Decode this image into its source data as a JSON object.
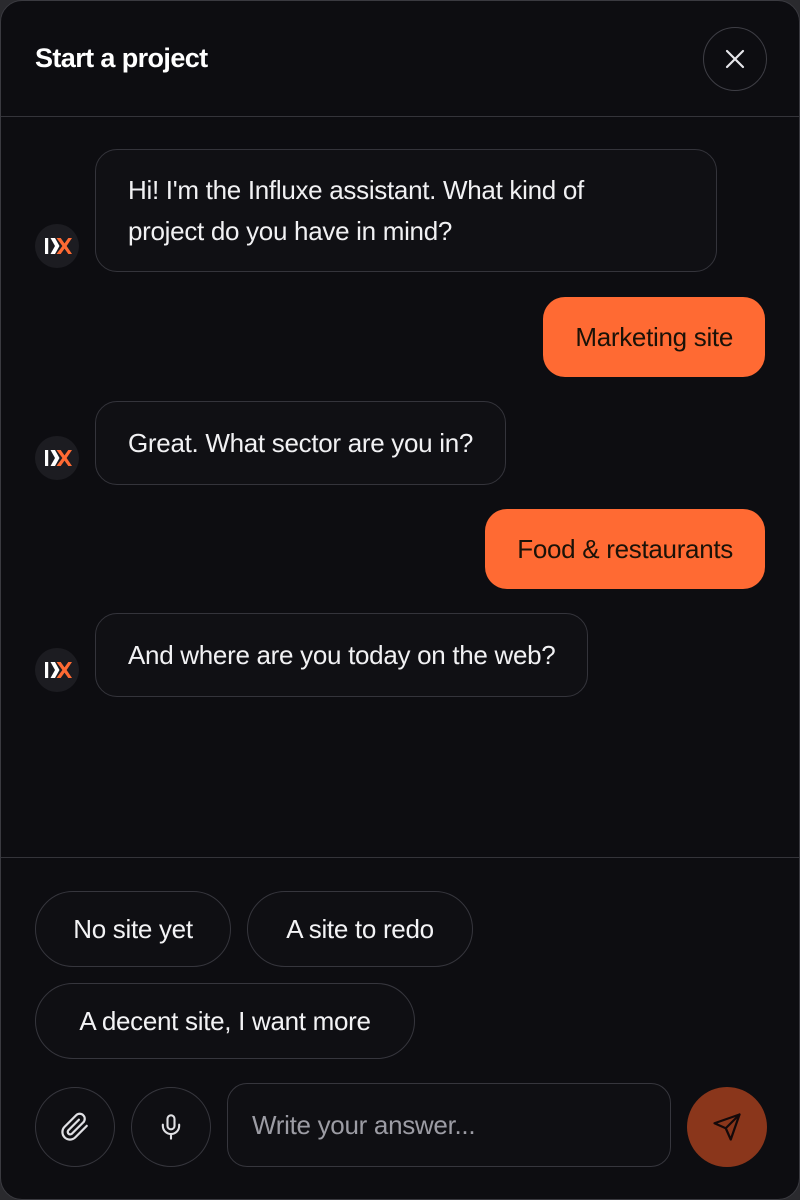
{
  "header": {
    "title": "Start a project"
  },
  "messages": [
    {
      "role": "bot",
      "lines": [
        "Hi! I'm the Influxe assistant. What kind of",
        "project do you have in mind?"
      ]
    },
    {
      "role": "user",
      "text": "Marketing site"
    },
    {
      "role": "bot",
      "text": "Great. What sector are you in?"
    },
    {
      "role": "user",
      "text": "Food & restaurants"
    },
    {
      "role": "bot",
      "text": "And where are you today on the web?"
    }
  ],
  "avatar_label": "IX",
  "quick_replies": [
    "No site yet",
    "A site to redo",
    "A decent site, I want more"
  ],
  "composer": {
    "placeholder": "Write your answer...",
    "value": ""
  },
  "icons": {
    "close": "close-icon",
    "attach": "paperclip-icon",
    "mic": "microphone-icon",
    "send": "send-icon",
    "avatar": "influxe-logo-icon"
  },
  "colors": {
    "accent": "#ff6a33",
    "send_button": "#8a361b",
    "background": "#0d0d11",
    "border": "#36363d"
  }
}
